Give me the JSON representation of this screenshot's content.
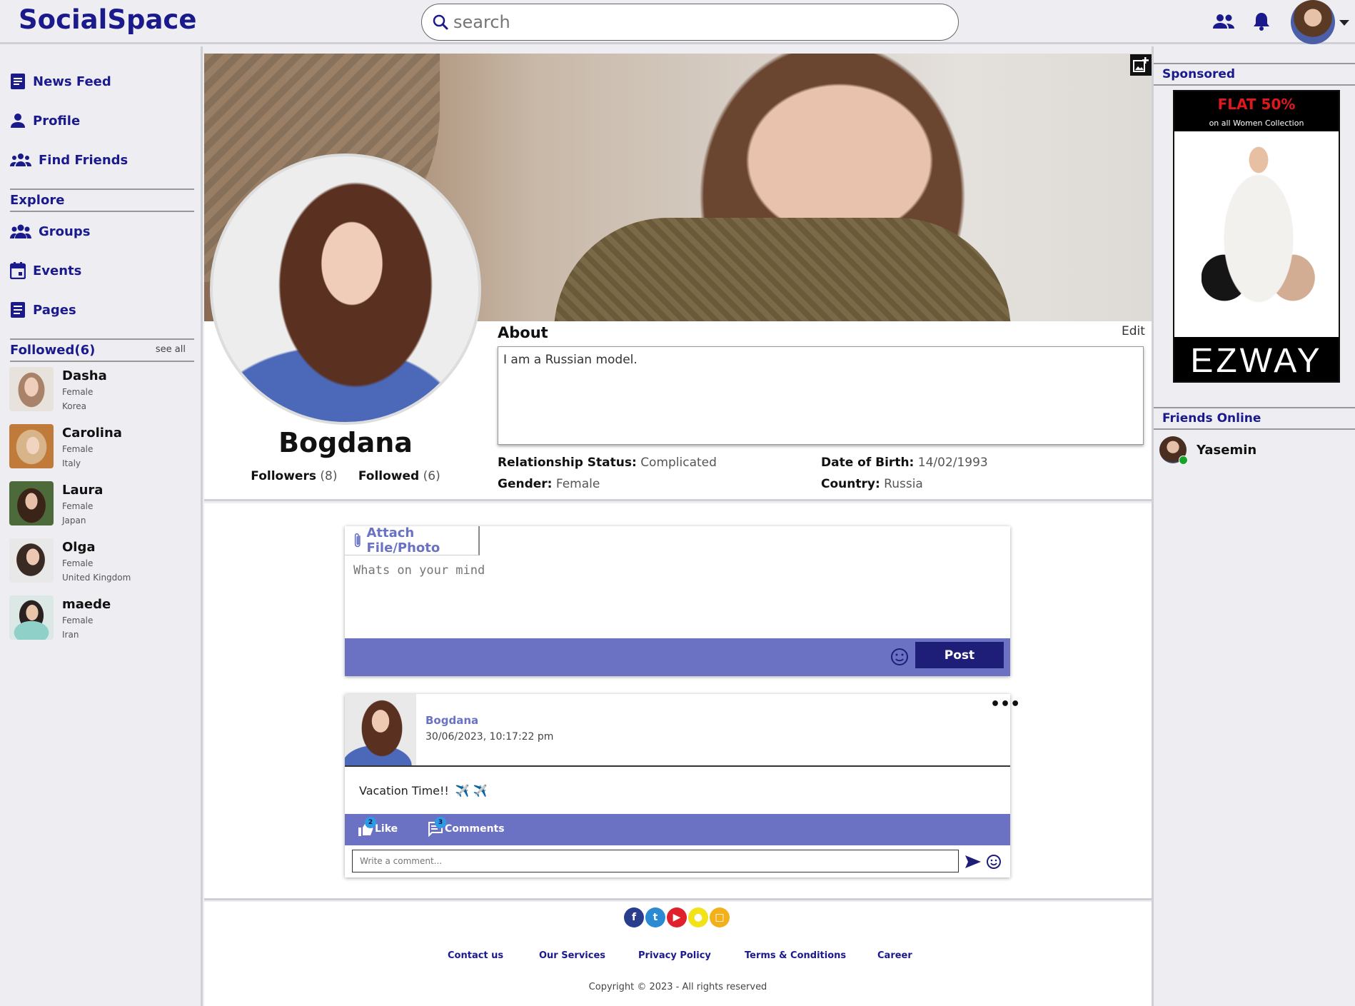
{
  "app": {
    "name": "SocialSpace"
  },
  "search": {
    "placeholder": "search"
  },
  "left_nav": {
    "items": [
      {
        "label": "News Feed",
        "icon": "article-icon"
      },
      {
        "label": "Profile",
        "icon": "person-icon"
      },
      {
        "label": "Find Friends",
        "icon": "group-icon"
      }
    ],
    "explore_heading": "Explore",
    "explore_items": [
      {
        "label": "Groups",
        "icon": "groups-icon"
      },
      {
        "label": "Events",
        "icon": "calendar-icon"
      },
      {
        "label": "Pages",
        "icon": "pages-icon"
      }
    ],
    "followed_heading": "Followed(6)",
    "see_all": "see all",
    "followed": [
      {
        "name": "Dasha",
        "gender": "Female",
        "country": "Korea"
      },
      {
        "name": "Carolina",
        "gender": "Female",
        "country": "Italy"
      },
      {
        "name": "Laura",
        "gender": "Female",
        "country": "Japan"
      },
      {
        "name": "Olga",
        "gender": "Female",
        "country": "United Kingdom"
      },
      {
        "name": "maede",
        "gender": "Female",
        "country": "Iran"
      }
    ]
  },
  "profile": {
    "name": "Bogdana",
    "followers_label": "Followers",
    "followers_count": "(8)",
    "followed_label": "Followed",
    "followed_count": "(6)",
    "about_heading": "About",
    "about_edit": "Edit",
    "about_text": "I am a Russian model.",
    "relationship_label": "Relationship Status:",
    "relationship_value": "Complicated",
    "gender_label": "Gender:",
    "gender_value": "Female",
    "dob_label": "Date of Birth:",
    "dob_value": "14/02/1993",
    "country_label": "Country:",
    "country_value": "Russia"
  },
  "composer": {
    "attach_label": "Attach File/Photo",
    "placeholder": "Whats on your mind",
    "post_button": "Post"
  },
  "post": {
    "author": "Bogdana",
    "timestamp": "30/06/2023, 10:17:22 pm",
    "text": "Vacation Time!!",
    "emoji": "✈️ ✈️",
    "like_label": "Like",
    "like_count": "2",
    "comments_label": "Comments",
    "comments_count": "3",
    "comment_placeholder": "Write a comment..."
  },
  "footer": {
    "socials": [
      "facebook-icon",
      "twitter-icon",
      "youtube-icon",
      "snapchat-icon",
      "instagram-icon"
    ],
    "links": [
      "Contact us",
      "Our Services",
      "Privacy Policy",
      "Terms & Conditions",
      "Career"
    ],
    "copyright": "Copyright © 2023 - All rights reserved"
  },
  "right_sidebar": {
    "sponsored_heading": "Sponsored",
    "ad": {
      "headline": "FLAT 50%",
      "subline": "on all Women Collection",
      "brand": "EZWAY"
    },
    "friends_online_heading": "Friends Online",
    "friends_online": [
      {
        "name": "Yasemin",
        "status": "online"
      }
    ]
  },
  "colors": {
    "brand": "#1a1a8c",
    "accent": "#6b72c4",
    "post_button": "#1e1e78",
    "online": "#1aa32a",
    "ad_red": "#e0181e"
  }
}
